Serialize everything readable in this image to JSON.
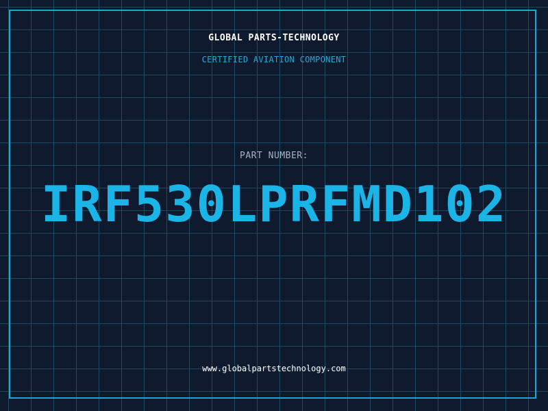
{
  "header": {
    "company": "GLOBAL PARTS-TECHNOLOGY",
    "tagline": "CERTIFIED AVIATION COMPONENT"
  },
  "part": {
    "label": "PART NUMBER:",
    "number": "IRF530LPRFMD102"
  },
  "footer": {
    "website": "www.globalpartstechnology.com"
  },
  "colors": {
    "background": "#0f1a2e",
    "grid": "#1d4a5e",
    "accent": "#1ab4e6",
    "frame": "#1aa9d4",
    "label": "#aab3c2",
    "text": "#ffffff"
  }
}
